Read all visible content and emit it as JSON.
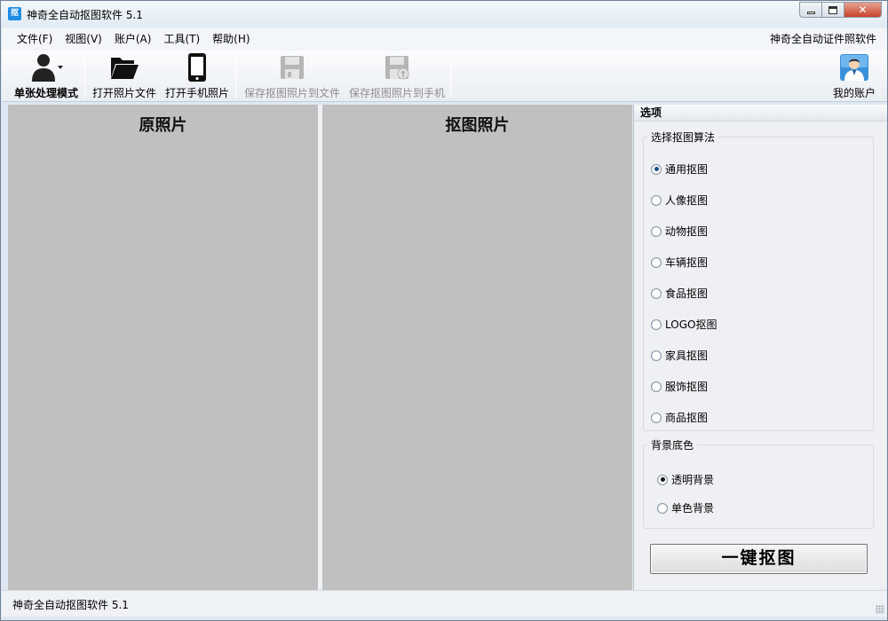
{
  "window": {
    "title": "神奇全自动抠图软件 5.1",
    "app_icon_char": "抠"
  },
  "menubar": {
    "items": [
      "文件(F)",
      "视图(V)",
      "账户(A)",
      "工具(T)",
      "帮助(H)"
    ],
    "right_text": "神奇全自动证件照软件"
  },
  "toolbar": {
    "single_mode": "单张处理模式",
    "open_file": "打开照片文件",
    "open_phone": "打开手机照片",
    "save_file": "保存抠图照片到文件",
    "save_phone": "保存抠图照片到手机",
    "account": "我的账户"
  },
  "panes": {
    "original": "原照片",
    "cutout": "抠图照片"
  },
  "options": {
    "header": "选项",
    "algo_legend": "选择抠图算法",
    "algorithms": [
      "通用抠图",
      "人像抠图",
      "动物抠图",
      "车辆抠图",
      "食品抠图",
      "LOGO抠图",
      "家具抠图",
      "服饰抠图",
      "商品抠图"
    ],
    "selected_algorithm": "通用抠图",
    "bg_legend": "背景底色",
    "backgrounds": [
      "透明背景",
      "单色背景"
    ],
    "selected_background": "透明背景",
    "action_button": "一键抠图"
  },
  "statusbar": {
    "text": "神奇全自动抠图软件 5.1"
  },
  "colors": {
    "pane_bg": "#c0c0c0",
    "accent": "#1f8ee6"
  }
}
